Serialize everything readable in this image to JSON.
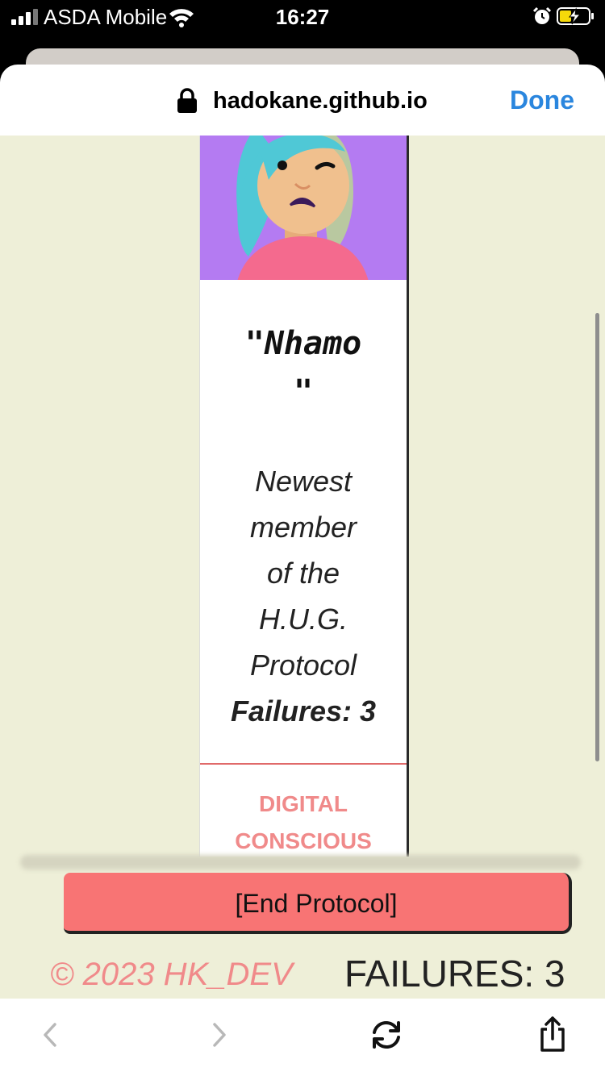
{
  "status_bar": {
    "carrier": "ASDA Mobile",
    "time": "16:27"
  },
  "browser": {
    "url": "hadokane.github.io",
    "done_label": "Done"
  },
  "card": {
    "title": "\"Nhamo\n\"",
    "description": "Newest\nmember\nof the\nH.U.G.\nProtocol",
    "failures_line": "Failures: 3",
    "tag": "DIGITAL\nCONSCIOUS"
  },
  "actions": {
    "end_protocol_label": "[End Protocol]"
  },
  "footer": {
    "copyright": "© 2023 HK_DEV",
    "failures": "FAILURES: 3"
  },
  "colors": {
    "accent": "#f87474",
    "page_bg": "#eeefd8",
    "avatar_bg": "#b47bf2",
    "link_blue": "#2a86de"
  },
  "icons": [
    "signal-icon",
    "wifi-icon",
    "alarm-icon",
    "battery-charging-icon",
    "lock-icon",
    "back-icon",
    "forward-icon",
    "reload-icon",
    "share-icon"
  ]
}
